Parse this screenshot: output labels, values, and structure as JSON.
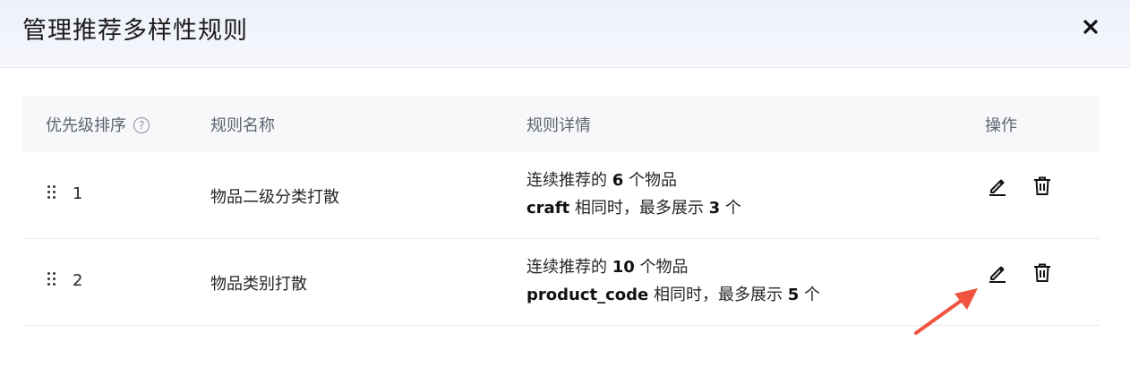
{
  "modal": {
    "title": "管理推荐多样性规则",
    "close_icon": "close-icon"
  },
  "table": {
    "columns": {
      "priority": "优先级排序",
      "name": "规则名称",
      "detail": "规则详情",
      "actions": "操作"
    },
    "help_icon_glyph": "?",
    "rows": [
      {
        "priority": "1",
        "name": "物品二级分类打散",
        "line1_prefix": "连续推荐的 ",
        "line1_count": "6",
        "line1_suffix": " 个物品",
        "line2_field": "craft",
        "line2_mid": " 相同时，最多展示 ",
        "line2_count": "3",
        "line2_suffix": " 个"
      },
      {
        "priority": "2",
        "name": "物品类别打散",
        "line1_prefix": "连续推荐的 ",
        "line1_count": "10",
        "line1_suffix": " 个物品",
        "line2_field": "product_code",
        "line2_mid": " 相同时，最多展示 ",
        "line2_count": "5",
        "line2_suffix": " 个"
      }
    ]
  },
  "colors": {
    "annotation_arrow": "#f0533e"
  }
}
